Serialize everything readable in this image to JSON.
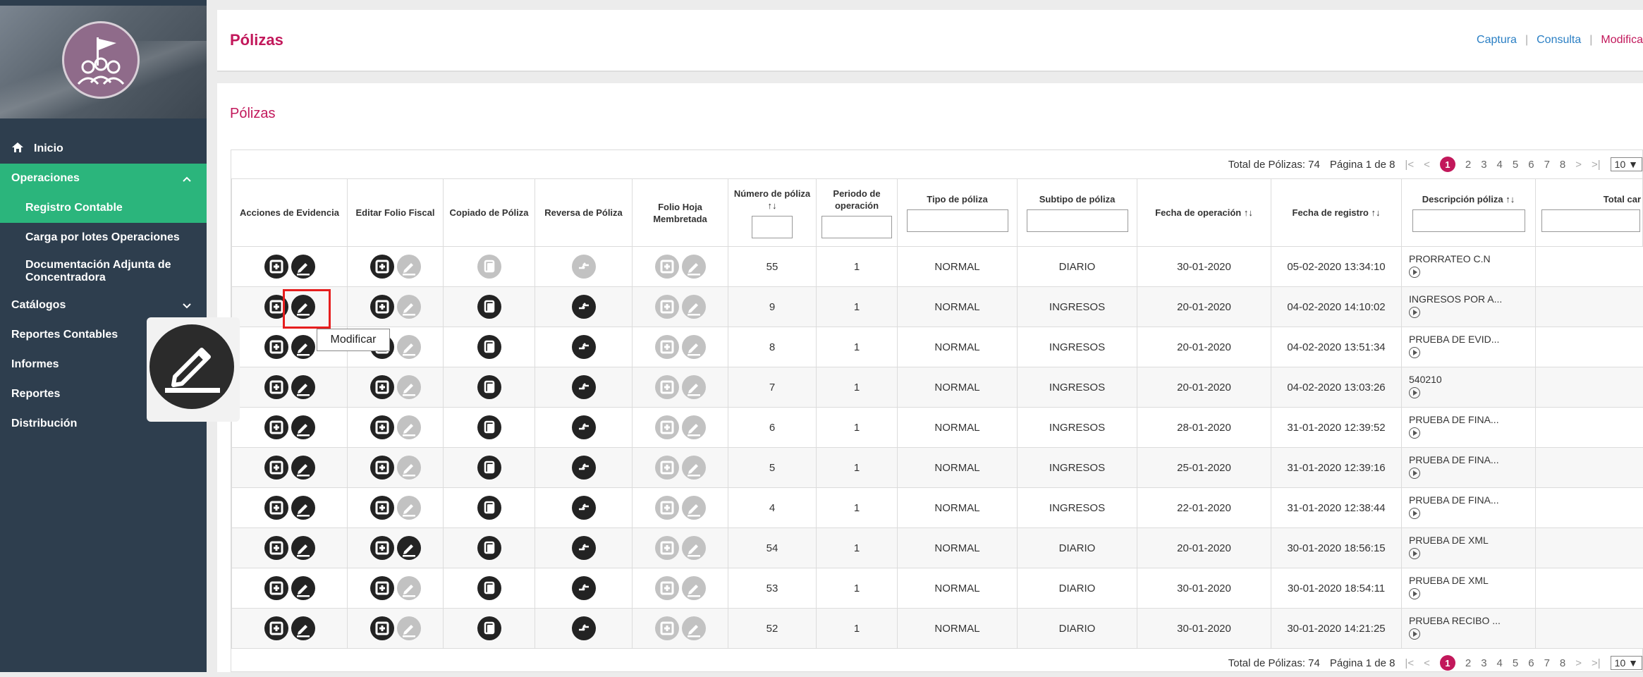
{
  "sidebar": {
    "items": [
      {
        "label": "Inicio",
        "icon": "home-icon"
      },
      {
        "label": "Operaciones"
      },
      {
        "label": "Catálogos"
      },
      {
        "label": "Reportes Contables"
      },
      {
        "label": "Informes"
      },
      {
        "label": "Reportes"
      },
      {
        "label": "Distribución"
      }
    ],
    "operaciones_sub": [
      {
        "label": "Registro Contable"
      },
      {
        "label": "Carga por lotes Operaciones"
      },
      {
        "label": "Documentación Adjunta de Concentradora"
      }
    ]
  },
  "header": {
    "title": "Pólizas",
    "breadcrumbs": [
      "Captura",
      "Consulta",
      "Modifica"
    ]
  },
  "main": {
    "subtitle": "Pólizas",
    "pager": {
      "total": "Total de Pólizas: 74",
      "page_info": "Página 1 de 8",
      "first": "|<",
      "prev": "<",
      "pages": [
        "1",
        "2",
        "3",
        "4",
        "5",
        "6",
        "7",
        "8"
      ],
      "current_page": "1",
      "next": ">",
      "last": ">|",
      "page_size": "10 ▼"
    },
    "columns": {
      "acciones": "Acciones de Evidencia",
      "editar": "Editar Folio Fiscal",
      "copiado": "Copiado de Póliza",
      "reversa": "Reversa de Póliza",
      "folio": "Folio Hoja Membretada",
      "numero": "Número de póliza",
      "periodo": "Periodo de operación",
      "tipo": "Tipo de póliza",
      "subtipo": "Subtipo de póliza",
      "fecha_op": "Fecha de operación",
      "fecha_reg": "Fecha de registro",
      "descripcion": "Descripción póliza",
      "total": "Total car"
    },
    "sort_glyph": "↑↓",
    "rows": [
      {
        "numero": "55",
        "periodo": "1",
        "tipo": "NORMAL",
        "subtipo": "DIARIO",
        "fecha_op": "30-01-2020",
        "fecha_reg": "05-02-2020 13:34:10",
        "descripcion": "PRORRATEO C.N"
      },
      {
        "numero": "9",
        "periodo": "1",
        "tipo": "NORMAL",
        "subtipo": "INGRESOS",
        "fecha_op": "20-01-2020",
        "fecha_reg": "04-02-2020 14:10:02",
        "descripcion": "INGRESOS POR A..."
      },
      {
        "numero": "8",
        "periodo": "1",
        "tipo": "NORMAL",
        "subtipo": "INGRESOS",
        "fecha_op": "20-01-2020",
        "fecha_reg": "04-02-2020 13:51:34",
        "descripcion": "PRUEBA DE EVID..."
      },
      {
        "numero": "7",
        "periodo": "1",
        "tipo": "NORMAL",
        "subtipo": "INGRESOS",
        "fecha_op": "20-01-2020",
        "fecha_reg": "04-02-2020 13:03:26",
        "descripcion": "540210"
      },
      {
        "numero": "6",
        "periodo": "1",
        "tipo": "NORMAL",
        "subtipo": "INGRESOS",
        "fecha_op": "28-01-2020",
        "fecha_reg": "31-01-2020 12:39:52",
        "descripcion": "PRUEBA DE FINA..."
      },
      {
        "numero": "5",
        "periodo": "1",
        "tipo": "NORMAL",
        "subtipo": "INGRESOS",
        "fecha_op": "25-01-2020",
        "fecha_reg": "31-01-2020 12:39:16",
        "descripcion": "PRUEBA DE FINA..."
      },
      {
        "numero": "4",
        "periodo": "1",
        "tipo": "NORMAL",
        "subtipo": "INGRESOS",
        "fecha_op": "22-01-2020",
        "fecha_reg": "31-01-2020 12:38:44",
        "descripcion": "PRUEBA DE FINA..."
      },
      {
        "numero": "54",
        "periodo": "1",
        "tipo": "NORMAL",
        "subtipo": "DIARIO",
        "fecha_op": "20-01-2020",
        "fecha_reg": "30-01-2020 18:56:15",
        "descripcion": "PRUEBA DE XML"
      },
      {
        "numero": "53",
        "periodo": "1",
        "tipo": "NORMAL",
        "subtipo": "DIARIO",
        "fecha_op": "30-01-2020",
        "fecha_reg": "30-01-2020 18:54:11",
        "descripcion": "PRUEBA DE XML"
      },
      {
        "numero": "52",
        "periodo": "1",
        "tipo": "NORMAL",
        "subtipo": "DIARIO",
        "fecha_op": "30-01-2020",
        "fecha_reg": "30-01-2020 14:21:25",
        "descripcion": "PRUEBA RECIBO ..."
      }
    ]
  },
  "tooltip": {
    "label": "Modificar"
  },
  "colors": {
    "accent": "#c2185b",
    "sidebar": "#2e3e4e",
    "active": "#2bb57c",
    "link": "#2a7fc4",
    "highlight": "#e61e1e"
  }
}
